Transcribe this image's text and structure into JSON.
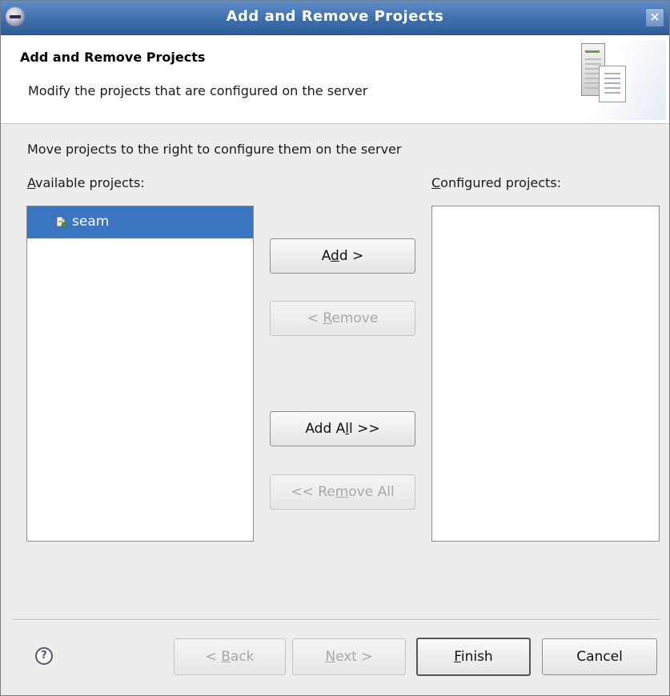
{
  "window": {
    "title": "Add and Remove Projects",
    "close_label": "✕"
  },
  "header": {
    "title": "Add and Remove Projects",
    "description": "Modify the projects that are configured on the server"
  },
  "body": {
    "instruction": "Move projects to the right to configure them on the server",
    "available": {
      "label_mnemonic": "A",
      "label_rest": "vailable projects:",
      "items": [
        {
          "label": "seam",
          "icon": "project-icon",
          "selected": true
        }
      ]
    },
    "configured": {
      "label_mnemonic": "C",
      "label_rest": "onfigured projects:",
      "items": []
    }
  },
  "buttons": {
    "add": {
      "pre": "A",
      "mnemonic": "d",
      "post": "d >",
      "enabled": true
    },
    "remove": {
      "pre": "< ",
      "mnemonic": "R",
      "post": "emove",
      "enabled": false
    },
    "add_all": {
      "pre": "Add A",
      "mnemonic": "l",
      "post": "l >>",
      "enabled": true
    },
    "remove_all": {
      "pre": "<< Re",
      "mnemonic": "m",
      "post": "ove All",
      "enabled": false
    }
  },
  "footer": {
    "help_icon": "help-icon",
    "help_glyph": "?",
    "back": {
      "pre": "< ",
      "mnemonic": "B",
      "post": "ack",
      "enabled": false
    },
    "next": {
      "pre": "",
      "mnemonic": "N",
      "post": "ext >",
      "enabled": false
    },
    "finish": {
      "pre": "",
      "mnemonic": "F",
      "post": "inish",
      "enabled": true,
      "default": true
    },
    "cancel": {
      "label": "Cancel",
      "enabled": true
    }
  },
  "colors": {
    "titlebar": "#3e6fae",
    "selection": "#3b74c0",
    "disabled_text": "#a8a8a8"
  }
}
